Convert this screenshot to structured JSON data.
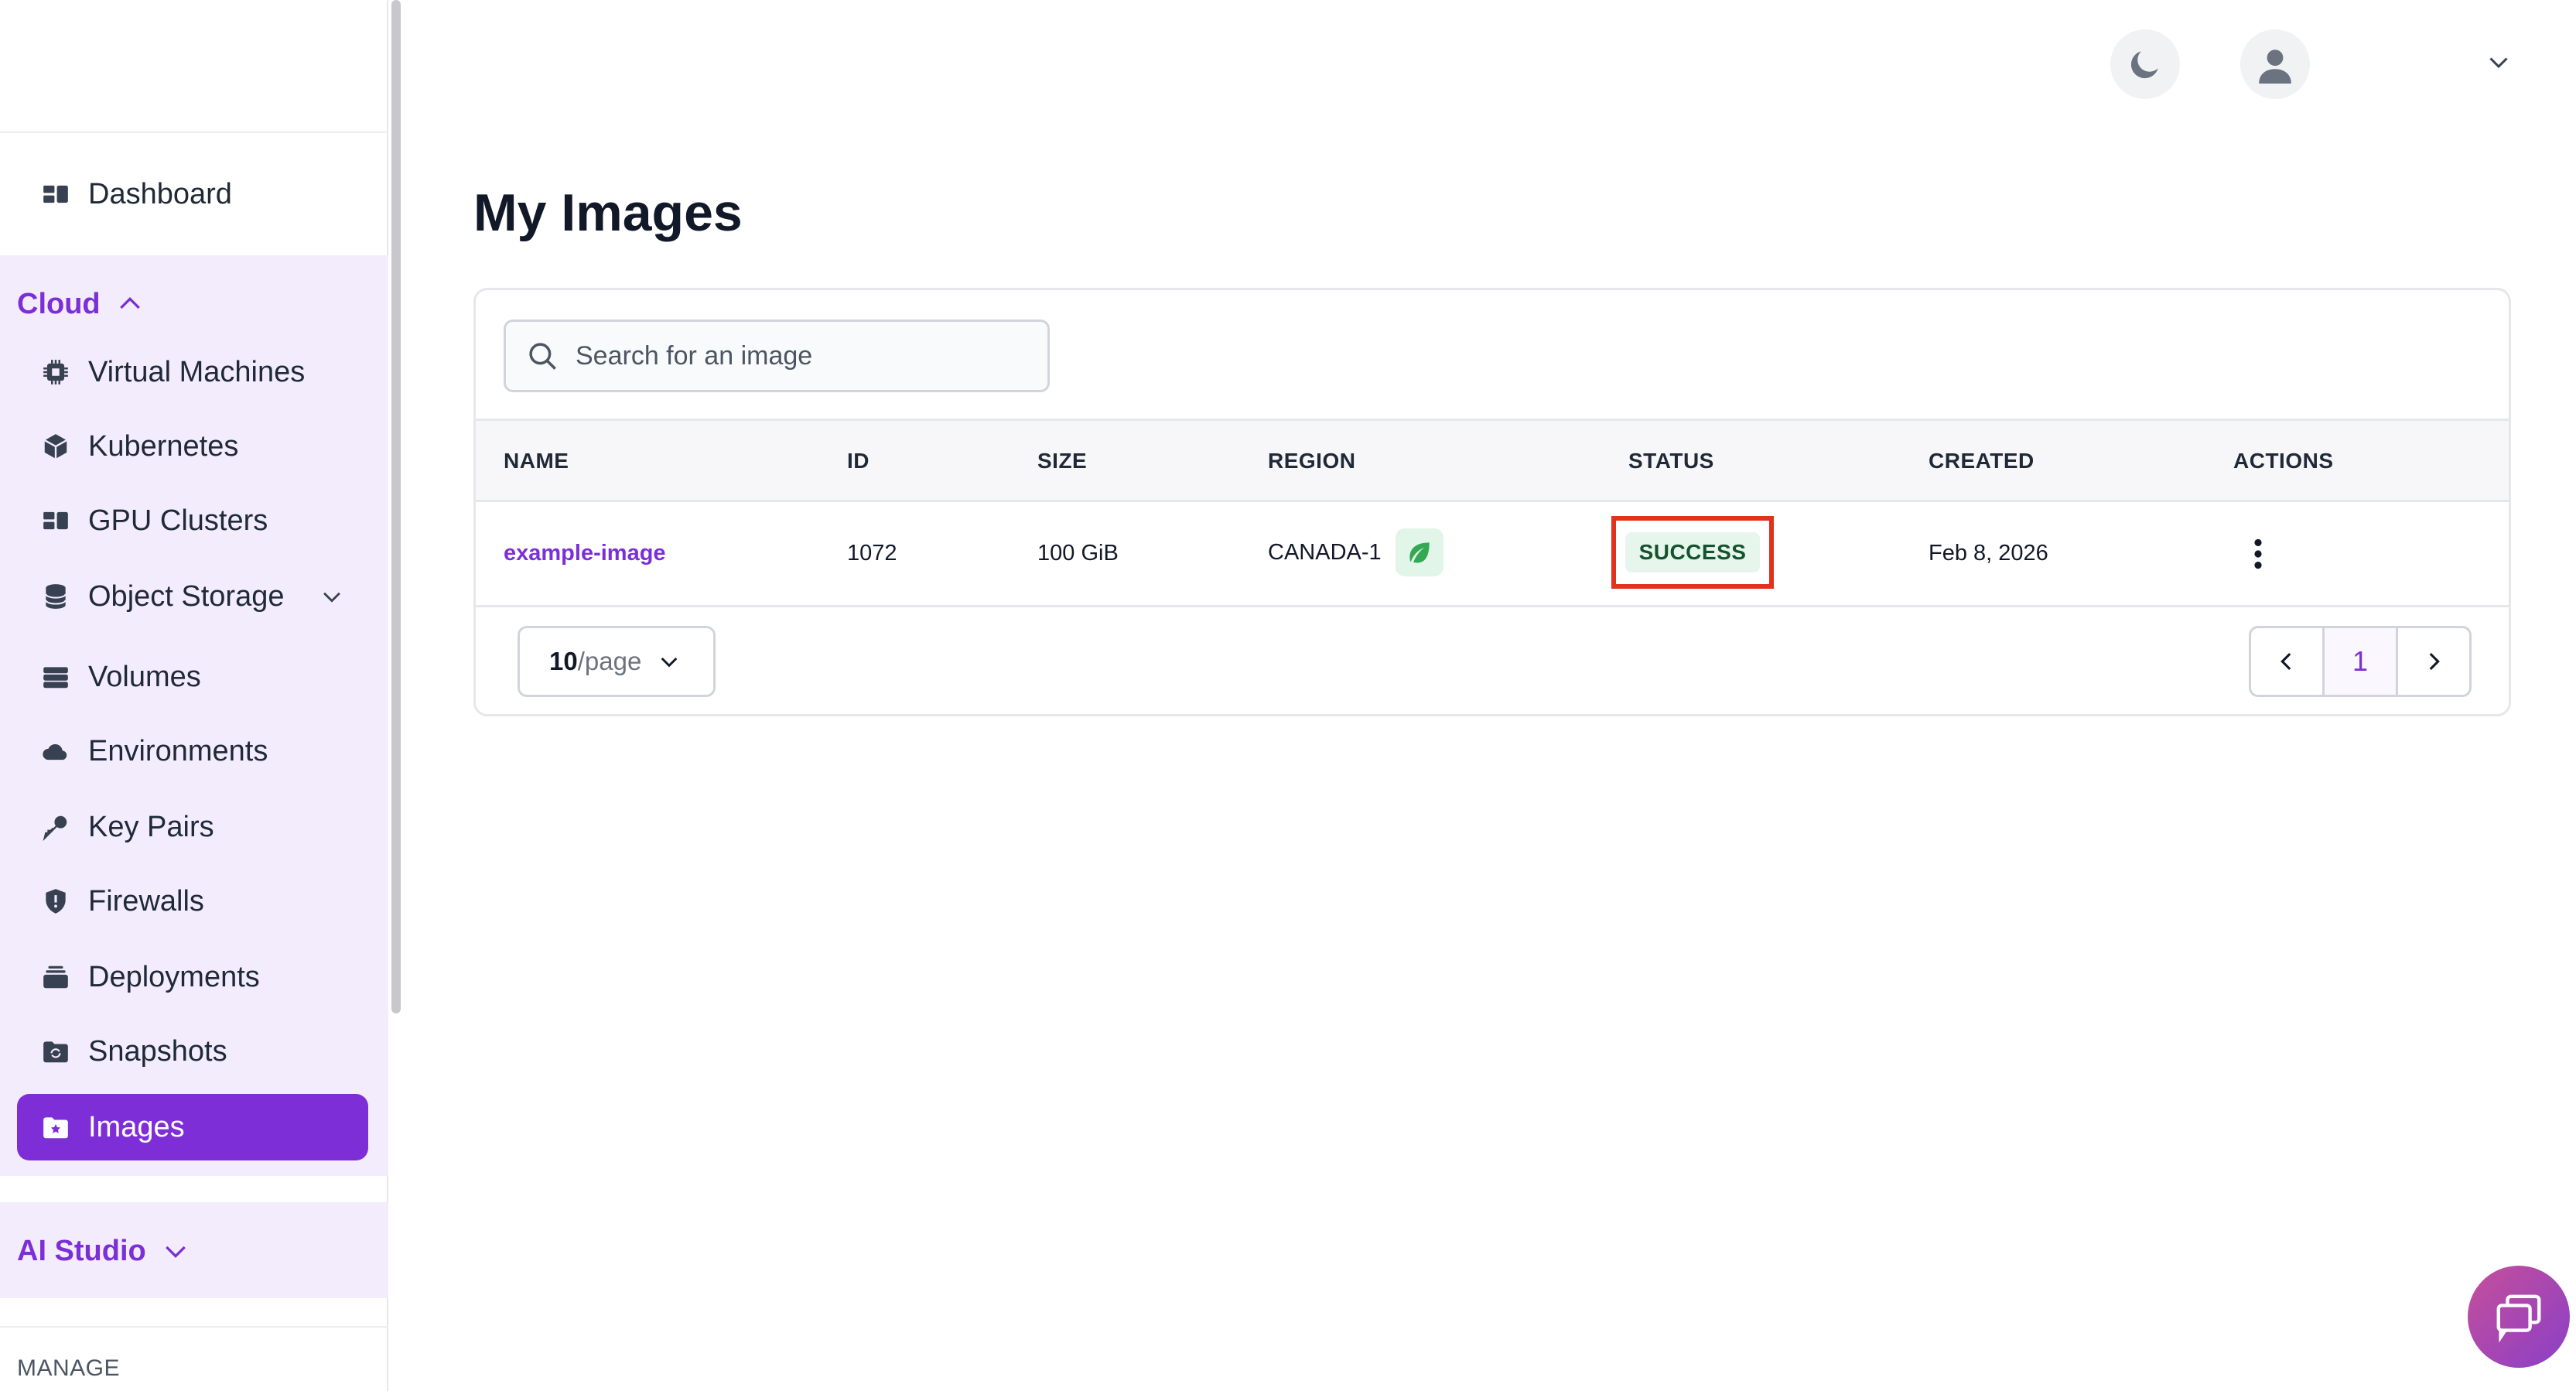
{
  "sidebar": {
    "dashboard_label": "Dashboard",
    "cloud_label": "Cloud",
    "cloud_items": [
      {
        "label": "Virtual Machines",
        "icon": "chip-icon"
      },
      {
        "label": "Kubernetes",
        "icon": "cube-icon"
      },
      {
        "label": "GPU Clusters",
        "icon": "grid-icon"
      },
      {
        "label": "Object Storage",
        "icon": "database-icon"
      },
      {
        "label": "Volumes",
        "icon": "server-icon"
      },
      {
        "label": "Environments",
        "icon": "cloud-icon"
      },
      {
        "label": "Key Pairs",
        "icon": "key-icon"
      },
      {
        "label": "Firewalls",
        "icon": "shield-icon"
      },
      {
        "label": "Deployments",
        "icon": "layers-icon"
      },
      {
        "label": "Snapshots",
        "icon": "snapshot-icon"
      },
      {
        "label": "Images",
        "icon": "image-folder-icon"
      }
    ],
    "active_item": "Images",
    "ai_studio_label": "AI Studio",
    "manage_label": "MANAGE"
  },
  "page": {
    "title": "My Images"
  },
  "search": {
    "placeholder": "Search for an image"
  },
  "table": {
    "headers": [
      "NAME",
      "ID",
      "SIZE",
      "REGION",
      "STATUS",
      "CREATED",
      "ACTIONS"
    ],
    "rows": [
      {
        "name": "example-image",
        "id": "1072",
        "size": "100 GiB",
        "region": "CANADA-1",
        "status": "SUCCESS",
        "created": "Feb 8, 2026"
      }
    ]
  },
  "pagination": {
    "per_page_value": "10",
    "per_page_unit": "/page",
    "current_page": "1"
  },
  "colors": {
    "accent": "#7e2ed6",
    "status_success_bg": "#e6f6ec",
    "highlight_border": "#e0321c"
  }
}
